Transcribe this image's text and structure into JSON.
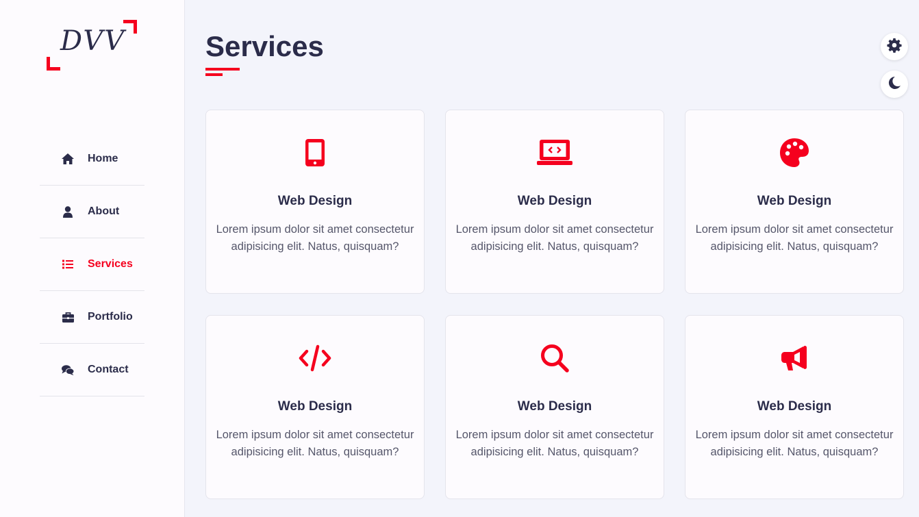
{
  "logo": {
    "text": "DVV"
  },
  "page": {
    "title": "Services"
  },
  "nav": {
    "items": [
      {
        "label": "Home",
        "icon": "home-icon"
      },
      {
        "label": "About",
        "icon": "user-icon"
      },
      {
        "label": "Services",
        "icon": "list-icon",
        "active": true
      },
      {
        "label": "Portfolio",
        "icon": "briefcase-icon"
      },
      {
        "label": "Contact",
        "icon": "comments-icon"
      }
    ]
  },
  "controls": {
    "settings_icon": "gear-icon",
    "theme_icon": "moon-icon"
  },
  "colors": {
    "accent": "#f5001e",
    "text": "#2b2c4a",
    "background": "#f3f4fb",
    "card": "#fdfbfe"
  },
  "services": [
    {
      "icon": "mobile-icon",
      "title": "Web Design",
      "text": "Lorem ipsum dolor sit amet consectetur adipisicing elit. Natus, quisquam?"
    },
    {
      "icon": "laptop-code-icon",
      "title": "Web Design",
      "text": "Lorem ipsum dolor sit amet consectetur adipisicing elit. Natus, quisquam?"
    },
    {
      "icon": "palette-icon",
      "title": "Web Design",
      "text": "Lorem ipsum dolor sit amet consectetur adipisicing elit. Natus, quisquam?"
    },
    {
      "icon": "code-icon",
      "title": "Web Design",
      "text": "Lorem ipsum dolor sit amet consectetur adipisicing elit. Natus, quisquam?"
    },
    {
      "icon": "search-icon",
      "title": "Web Design",
      "text": "Lorem ipsum dolor sit amet consectetur adipisicing elit. Natus, quisquam?"
    },
    {
      "icon": "bullhorn-icon",
      "title": "Web Design",
      "text": "Lorem ipsum dolor sit amet consectetur adipisicing elit. Natus, quisquam?"
    }
  ]
}
